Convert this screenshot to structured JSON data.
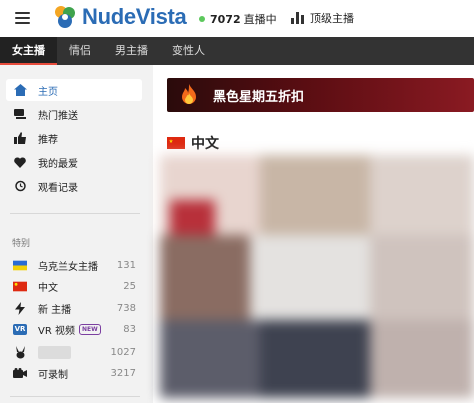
{
  "header": {
    "logo_text": "NudeVista",
    "live_count": "7072",
    "live_label": "直播中",
    "top_hosts_label": "顶级主播"
  },
  "nav": {
    "tabs": [
      {
        "label": "女主播",
        "active": true
      },
      {
        "label": "情侣",
        "active": false
      },
      {
        "label": "男主播",
        "active": false
      },
      {
        "label": "变性人",
        "active": false
      }
    ]
  },
  "sidebar": {
    "main_items": [
      {
        "label": "主页",
        "icon": "home-icon",
        "active": true
      },
      {
        "label": "热门推送",
        "icon": "flame-icon",
        "active": false
      },
      {
        "label": "推荐",
        "icon": "thumbs-up-icon",
        "active": false
      },
      {
        "label": "我的最爱",
        "icon": "heart-icon",
        "active": false
      },
      {
        "label": "观看记录",
        "icon": "history-icon",
        "active": false
      }
    ],
    "section_label": "特别",
    "special_items": [
      {
        "label": "乌克兰女主播",
        "icon": "ukraine-flag-icon",
        "count": "131"
      },
      {
        "label": "中文",
        "icon": "china-flag-icon",
        "count": "25"
      },
      {
        "label": "新 主播",
        "icon": "lightning-icon",
        "count": "738"
      },
      {
        "label": "VR 视频",
        "icon": "vr-icon",
        "badge": "NEW",
        "icon_text": "VR",
        "count": "83"
      },
      {
        "label": "",
        "icon": "bunny-icon",
        "count": "1027"
      },
      {
        "label": "可录制",
        "icon": "camera-icon",
        "count": "3217"
      }
    ]
  },
  "main": {
    "banner_text": "黑色星期五折扣",
    "section_title": "中文"
  },
  "colors": {
    "brand": "#2b6cb5",
    "nav_bg": "#333333",
    "live_dot": "#5cc85c",
    "banner_bg": "#5a0d12"
  }
}
